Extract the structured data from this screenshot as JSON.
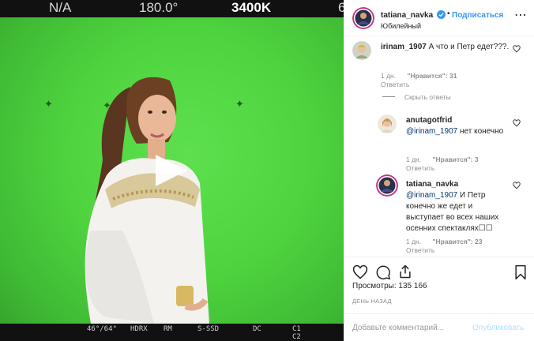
{
  "video": {
    "hud_top": {
      "left": "N/A",
      "mid": "180.0°",
      "right": "3400K",
      "edge": "6"
    },
    "hud_bottom": [
      "46°/64°",
      "HDRX",
      "RM",
      "S-SSD",
      "DC",
      "C1",
      "C2"
    ]
  },
  "post": {
    "author": "tatiana_navka",
    "separator": "•",
    "follow_label": "Подписаться",
    "location": "Юбилейный",
    "more_label": "⋯"
  },
  "comments": [
    {
      "user": "irinam_1907",
      "text": "А что и Петр едет???.",
      "age": "1 дн.",
      "likes": "\"Нравится\": 31",
      "reply": "Ответить"
    }
  ],
  "hide_replies_label": "Скрыть ответы",
  "replies": [
    {
      "user": "anutagotfrid",
      "mention": "@irinam_1907",
      "text": " нет конечно",
      "age": "1 дн.",
      "likes": "\"Нравится\": 3",
      "reply": "Ответить"
    },
    {
      "user": "tatiana_navka",
      "mention": "@irinam_1907",
      "text": " И Петр конечно же едет и выступает во всех наших осенних спектаклях☐☐",
      "age": "1 дн.",
      "likes": "\"Нравится\": 23",
      "reply": "Ответить"
    }
  ],
  "stats": {
    "views_label": "Просмотры:",
    "views_value": "135 166",
    "date": "ДЕНЬ НАЗАД"
  },
  "composer": {
    "placeholder": "Добавьте комментарий...",
    "publish_label": "Опубликовать"
  },
  "colors": {
    "link_blue": "#3897f0",
    "publish_disabled": "#b2dffc",
    "chroma_green": "#4fd43f"
  }
}
